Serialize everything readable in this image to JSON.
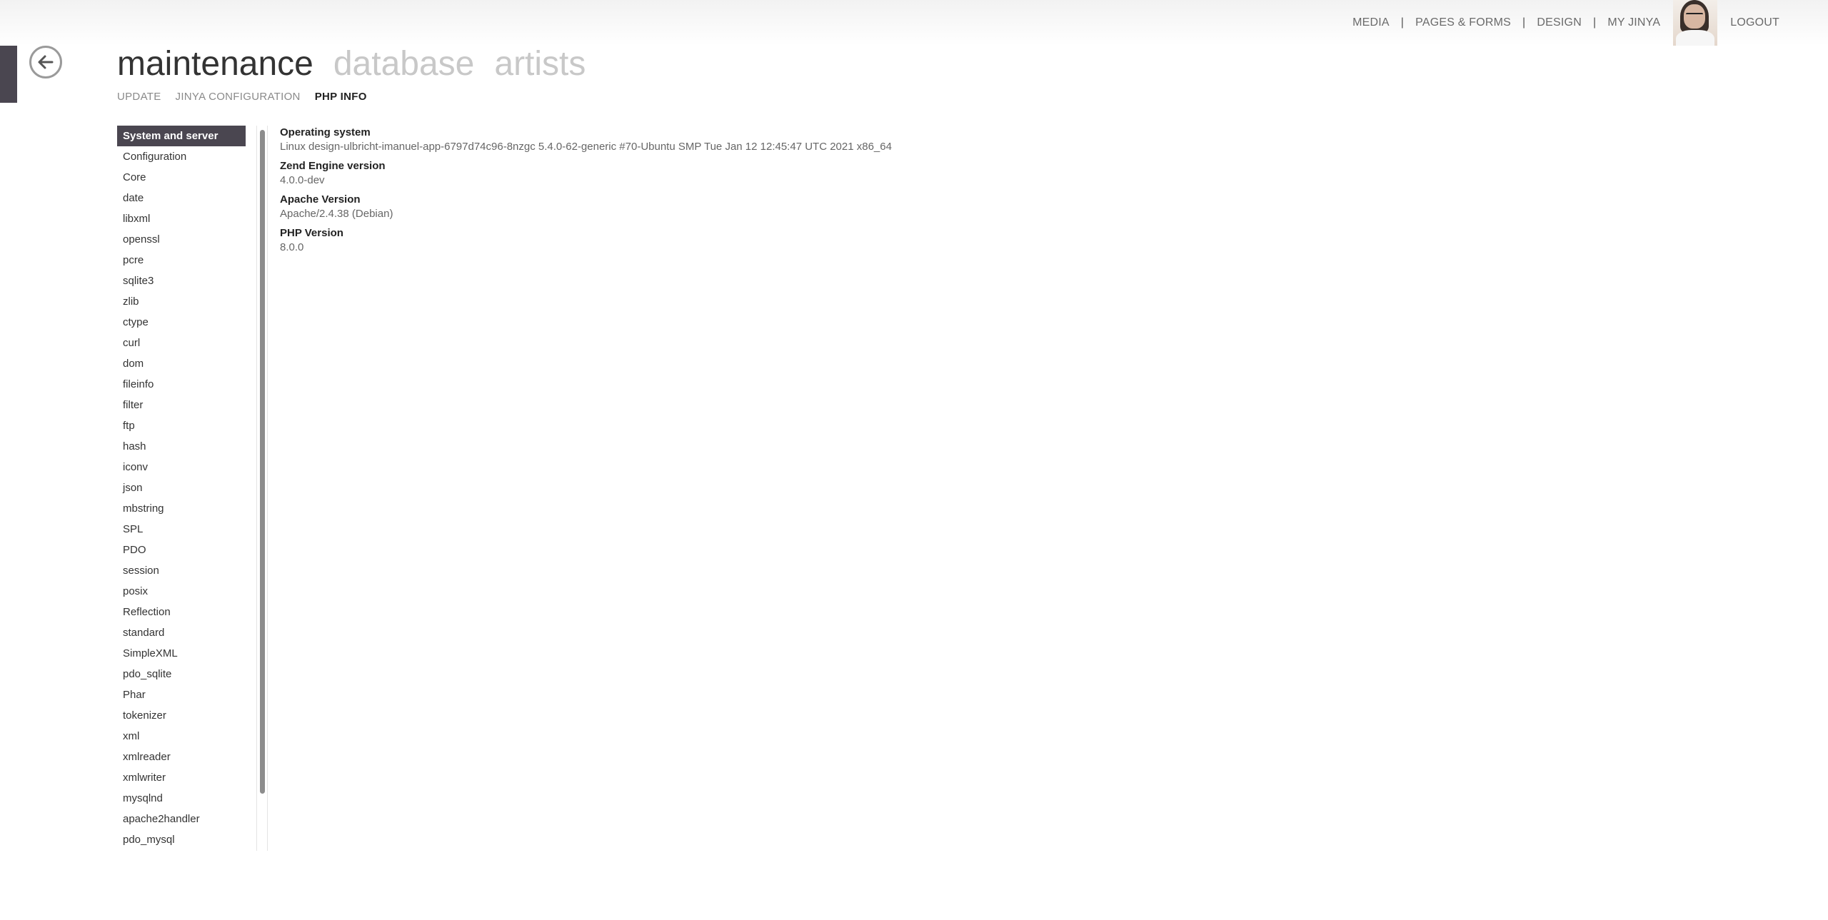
{
  "topnav": {
    "items": [
      "MEDIA",
      "PAGES & FORMS",
      "DESIGN",
      "MY JINYA"
    ],
    "separator": "|",
    "logout": "LOGOUT"
  },
  "main_tabs": [
    {
      "label": "maintenance",
      "active": true
    },
    {
      "label": "database",
      "active": false
    },
    {
      "label": "artists",
      "active": false
    }
  ],
  "sub_tabs": [
    {
      "label": "UPDATE",
      "active": false
    },
    {
      "label": "JINYA CONFIGURATION",
      "active": false
    },
    {
      "label": "PHP INFO",
      "active": true
    }
  ],
  "sidebar": {
    "items": [
      "System and server",
      "Configuration",
      "Core",
      "date",
      "libxml",
      "openssl",
      "pcre",
      "sqlite3",
      "zlib",
      "ctype",
      "curl",
      "dom",
      "fileinfo",
      "filter",
      "ftp",
      "hash",
      "iconv",
      "json",
      "mbstring",
      "SPL",
      "PDO",
      "session",
      "posix",
      "Reflection",
      "standard",
      "SimpleXML",
      "pdo_sqlite",
      "Phar",
      "tokenizer",
      "xml",
      "xmlreader",
      "xmlwriter",
      "mysqlnd",
      "apache2handler",
      "pdo_mysql"
    ],
    "active_index": 0
  },
  "content": {
    "entries": [
      {
        "label": "Operating system",
        "value": "Linux design-ulbricht-imanuel-app-6797d74c96-8nzgc 5.4.0-62-generic #70-Ubuntu SMP Tue Jan 12 12:45:47 UTC 2021 x86_64"
      },
      {
        "label": "Zend Engine version",
        "value": "4.0.0-dev"
      },
      {
        "label": "Apache Version",
        "value": "Apache/2.4.38 (Debian)"
      },
      {
        "label": "PHP Version",
        "value": "8.0.0"
      }
    ]
  },
  "colors": {
    "accent": "#4a4650",
    "inactive_heading": "#c8c8c8"
  },
  "icons": {
    "back": "arrow-left-icon",
    "avatar": "user-avatar"
  }
}
